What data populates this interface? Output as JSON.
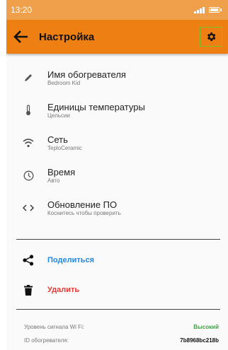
{
  "status_bar": {
    "time": "13:20"
  },
  "app_bar": {
    "title": "Настройка"
  },
  "settings": [
    {
      "name": "heater-name",
      "icon": "pencil-icon",
      "title": "Имя обогревателя",
      "subtitle": "Bedroom Kid"
    },
    {
      "name": "temperature-units",
      "icon": "thermometer-icon",
      "title": "Единицы температуры",
      "subtitle": "Цельсии"
    },
    {
      "name": "network",
      "icon": "wifi-icon",
      "title": "Сеть",
      "subtitle": "TeploCeramic"
    },
    {
      "name": "time",
      "icon": "clock-icon",
      "title": "Время",
      "subtitle": "Авто"
    },
    {
      "name": "firmware-update",
      "icon": "code-icon",
      "title": "Обновление ПО",
      "subtitle": "Коснитесь чтобы проверить"
    }
  ],
  "actions": {
    "share": {
      "label": "Поделиться",
      "color": "#1e88e5",
      "icon": "share-icon"
    },
    "delete": {
      "label": "Удалить",
      "color": "#e53935",
      "icon": "trash-icon"
    }
  },
  "info": {
    "wifi_label": "Уровень сигнала Wi Fi:",
    "wifi_value": "Высокий",
    "wifi_value_color": "#43a047",
    "id_label": "ID обогревателя:",
    "id_value": "7b8968bc218b"
  },
  "colors": {
    "app_bar": "#ee7f12",
    "status_bar": "#f0a04a",
    "highlight": "#7fbf2a"
  }
}
